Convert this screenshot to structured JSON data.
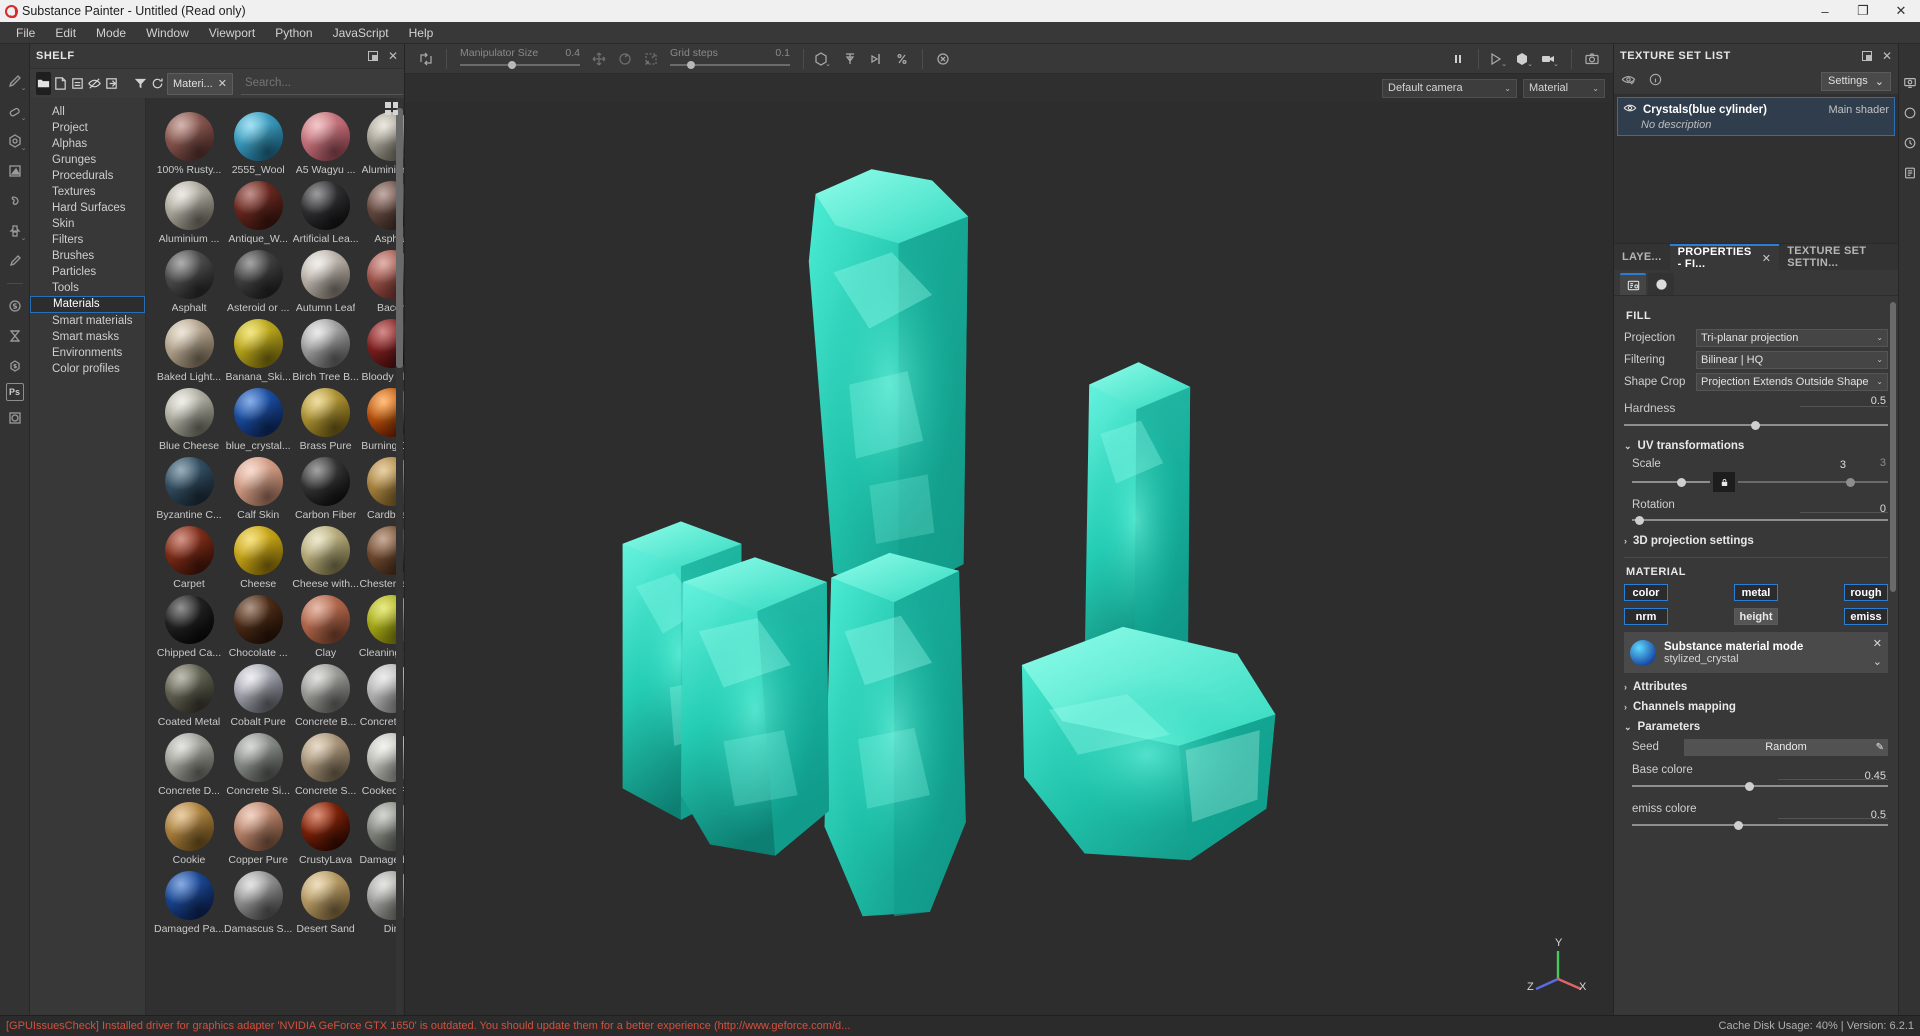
{
  "window": {
    "title": "Substance Painter - Untitled (Read only)",
    "minimize": "–",
    "maximize": "❐",
    "close": "✕"
  },
  "menubar": {
    "items": [
      "File",
      "Edit",
      "Mode",
      "Window",
      "Viewport",
      "Python",
      "JavaScript",
      "Help"
    ]
  },
  "left_toolbar": {
    "icons": [
      "paint-brush-icon",
      "eraser-icon",
      "projection-icon",
      "polygon-fill-icon",
      "smudge-icon",
      "clone-stamp-icon",
      "color-picker-icon",
      "substance-source-icon",
      "baking-icon",
      "substance-share-icon",
      "photoshop-icon",
      "export-icon"
    ]
  },
  "shelf": {
    "title": "SHELF",
    "dock_icon": "dock-icon",
    "close_icon": "close-icon",
    "toolbar": {
      "buttons": [
        "folder-icon",
        "new-file-icon",
        "save-icon",
        "hide-icon",
        "import-icon",
        "filter-icon",
        "refresh-icon"
      ],
      "chip_label": "Materi...",
      "chip_close": "✕",
      "search_placeholder": "Search..."
    },
    "categories": [
      {
        "label": "All",
        "selected": false
      },
      {
        "label": "Project",
        "selected": false
      },
      {
        "label": "Alphas",
        "selected": false
      },
      {
        "label": "Grunges",
        "selected": false
      },
      {
        "label": "Procedurals",
        "selected": false
      },
      {
        "label": "Textures",
        "selected": false
      },
      {
        "label": "Hard Surfaces",
        "selected": false
      },
      {
        "label": "Skin",
        "selected": false
      },
      {
        "label": "Filters",
        "selected": false
      },
      {
        "label": "Brushes",
        "selected": false
      },
      {
        "label": "Particles",
        "selected": false
      },
      {
        "label": "Tools",
        "selected": false
      },
      {
        "label": "Materials",
        "selected": true
      },
      {
        "label": "Smart materials",
        "selected": false
      },
      {
        "label": "Smart masks",
        "selected": false
      },
      {
        "label": "Environments",
        "selected": false
      },
      {
        "label": "Color profiles",
        "selected": false
      }
    ],
    "grid_view_icon": "grid-view-icon",
    "materials": [
      {
        "label": "100% Rusty...",
        "c1": "#b07a70",
        "c2": "#5e3430"
      },
      {
        "label": "2555_Wool",
        "c1": "#5cc8e8",
        "c2": "#1e6f92"
      },
      {
        "label": "A5 Wagyu ...",
        "c1": "#e79a9f",
        "c2": "#a04b58"
      },
      {
        "label": "Aluminium ...",
        "c1": "#d9d4c6",
        "c2": "#6e6a60"
      },
      {
        "label": "Aluminium ...",
        "c1": "#dedbd0",
        "c2": "#7b776c"
      },
      {
        "label": "Antique_W...",
        "c1": "#8f3b31",
        "c2": "#40160f"
      },
      {
        "label": "Artificial Lea...",
        "c1": "#4d4d50",
        "c2": "#141416"
      },
      {
        "label": "Asphalt",
        "c1": "#8f6a5e",
        "c2": "#3b2a24"
      },
      {
        "label": "Asphalt",
        "c1": "#6e6e6e",
        "c2": "#2a2a2a"
      },
      {
        "label": "Asteroid or ...",
        "c1": "#5c5c5c",
        "c2": "#242424"
      },
      {
        "label": "Autumn Leaf",
        "c1": "#e8e2db",
        "c2": "#8a8278"
      },
      {
        "label": "Bacon",
        "c1": "#c8766a",
        "c2": "#6e2f2a"
      },
      {
        "label": "Baked Light...",
        "c1": "#ded0bb",
        "c2": "#8a7a64"
      },
      {
        "label": "Banana_Ski...",
        "c1": "#e8d22a",
        "c2": "#8a7a10"
      },
      {
        "label": "Birch Tree B...",
        "c1": "#d8d8d8",
        "c2": "#6a6a6a"
      },
      {
        "label": "Bloody Flesh",
        "c1": "#b03030",
        "c2": "#4a0e0e"
      },
      {
        "label": "Blue Cheese",
        "c1": "#e2e2d6",
        "c2": "#7a7a6e"
      },
      {
        "label": "blue_crystal...",
        "c1": "#2a6fd4",
        "c2": "#0d2a66"
      },
      {
        "label": "Brass Pure",
        "c1": "#e0c258",
        "c2": "#7a6414"
      },
      {
        "label": "Burning Co...",
        "c1": "#ff8c1a",
        "c2": "#6e1a00"
      },
      {
        "label": "Byzantine C...",
        "c1": "#4a6e86",
        "c2": "#1c2e3c"
      },
      {
        "label": "Calf Skin",
        "c1": "#f0c0ab",
        "c2": "#b07a62"
      },
      {
        "label": "Carbon Fiber",
        "c1": "#5a5a5a",
        "c2": "#121212"
      },
      {
        "label": "Cardboard",
        "c1": "#d4a95e",
        "c2": "#7a5c24"
      },
      {
        "label": "Carpet",
        "c1": "#b0442c",
        "c2": "#4a1608"
      },
      {
        "label": "Cheese",
        "c1": "#f0cc2a",
        "c2": "#9a7c0a"
      },
      {
        "label": "Cheese with...",
        "c1": "#e0d6a8",
        "c2": "#8a8050"
      },
      {
        "label": "Chesterfield...",
        "c1": "#9a6a48",
        "c2": "#452a18"
      },
      {
        "label": "Chipped Ca...",
        "c1": "#3a3a3a",
        "c2": "#0a0a0a"
      },
      {
        "label": "Chocolate ...",
        "c1": "#6e4428",
        "c2": "#2a1408"
      },
      {
        "label": "Clay",
        "c1": "#d4866a",
        "c2": "#8a4a30"
      },
      {
        "label": "Cleaning Sp...",
        "c1": "#d4d82a",
        "c2": "#7a7c0a"
      },
      {
        "label": "Coated Metal",
        "c1": "#8a8a78",
        "c2": "#3c3c30"
      },
      {
        "label": "Cobalt Pure",
        "c1": "#e0e0e8",
        "c2": "#6a6a76"
      },
      {
        "label": "Concrete B...",
        "c1": "#c8c8c4",
        "c2": "#6e6e6a"
      },
      {
        "label": "Concrete Cl...",
        "c1": "#dcdcdc",
        "c2": "#8a8a8a"
      },
      {
        "label": "Concrete D...",
        "c1": "#cfcfc8",
        "c2": "#74746e"
      },
      {
        "label": "Concrete Si...",
        "c1": "#b8bcb8",
        "c2": "#5e625e"
      },
      {
        "label": "Concrete S...",
        "c1": "#d4bea0",
        "c2": "#7c6c54"
      },
      {
        "label": "Cooked Rice",
        "c1": "#e8e8e2",
        "c2": "#8e8e88"
      },
      {
        "label": "Cookie",
        "c1": "#d8a860",
        "c2": "#7c5a20"
      },
      {
        "label": "Copper Pure",
        "c1": "#e8b098",
        "c2": "#8a5a42"
      },
      {
        "label": "CrustyLava",
        "c1": "#c03c14",
        "c2": "#3a0a00"
      },
      {
        "label": "Damaged C...",
        "c1": "#b0b4ac",
        "c2": "#5a5e56"
      },
      {
        "label": "Damaged Pa...",
        "c1": "#2a68c8",
        "c2": "#0c2458"
      },
      {
        "label": "Damascus S...",
        "c1": "#cfcfcf",
        "c2": "#5a5a5a"
      },
      {
        "label": "Desert Sand",
        "c1": "#e0c48a",
        "c2": "#8a7040"
      },
      {
        "label": "Dirt",
        "c1": "#d0d0cc",
        "c2": "#70706c"
      }
    ]
  },
  "viewport": {
    "toolbar": {
      "transform_icon": "transform-icon",
      "manipulator": {
        "label": "Manipulator Size",
        "value": "0.4",
        "knob_pct": 40
      },
      "move_icon": "move-icon",
      "rotate_icon": "rotate-icon",
      "scale_icon": "scale-icon",
      "grid": {
        "label": "Grid steps",
        "value": "0.1",
        "knob_pct": 14
      },
      "cube_icon": "cube-icon",
      "symmetry_icon": "symmetry-icon",
      "mirror_icon": "mirror-icon",
      "fraction_icon": "fraction-icon",
      "reset_icon": "reset-icon",
      "pause_icon": "pause-icon",
      "viewmode_2d_icon": "view-2d-icon",
      "viewmode_3d_icon": "view-3d-icon",
      "viewmode_camera_icon": "view-camera-icon",
      "screenshot_icon": "screenshot-icon"
    },
    "camera_combo": "Default camera",
    "shader_combo": "Material",
    "axis": {
      "x": "X",
      "y": "Y",
      "z": "Z"
    }
  },
  "texture_set_list": {
    "title": "TEXTURE SET LIST",
    "dock_icon": "dock-icon",
    "close_icon": "close-icon",
    "eye_icon": "eye-toggle-icon",
    "info_icon": "info-icon",
    "settings_label": "Settings",
    "settings_arrow": "⌄",
    "rows": [
      {
        "name": "Crystals(blue cylinder)",
        "shader": "Main shader",
        "description": "No description",
        "visible_icon": "eye-icon"
      }
    ]
  },
  "properties": {
    "tabs": [
      {
        "label": "LAYE...",
        "active": false,
        "closable": false
      },
      {
        "label": "PROPERTIES - FI...",
        "active": true,
        "closable": true,
        "close": "✕"
      },
      {
        "label": "TEXTURE SET SETTIN...",
        "active": false,
        "closable": false
      }
    ],
    "subtabs": [
      {
        "icon": "properties-icon",
        "active": true
      },
      {
        "icon": "material-ball-icon",
        "active": false
      }
    ],
    "fill": {
      "section_title": "FILL",
      "projection": {
        "label": "Projection",
        "value": "Tri-planar projection"
      },
      "filtering": {
        "label": "Filtering",
        "value": "Bilinear | HQ"
      },
      "shape_crop": {
        "label": "Shape Crop",
        "value": "Projection Extends Outside Shape"
      },
      "hardness": {
        "label": "Hardness",
        "value": "0.5",
        "knob_pct": 48
      },
      "uv_transformations": {
        "label": "UV transformations",
        "expanded": true,
        "scale": {
          "label": "Scale",
          "value_left": "3",
          "value_right": "3",
          "knob_left_pct": 58,
          "knob_right_pct": 72,
          "lock_icon": "lock-icon"
        },
        "rotation": {
          "label": "Rotation",
          "value": "0",
          "knob_pct": 2
        }
      },
      "projection_3d": {
        "label": "3D projection settings",
        "expanded": false
      }
    },
    "material": {
      "section_title": "MATERIAL",
      "channels": [
        {
          "label": "color",
          "on": true
        },
        {
          "label": "metal",
          "on": true
        },
        {
          "label": "rough",
          "on": true
        },
        {
          "label": "nrm",
          "on": true
        },
        {
          "label": "height",
          "on": false
        },
        {
          "label": "emiss",
          "on": true
        }
      ],
      "mode": {
        "title": "Substance material mode",
        "value": "stylized_crystal",
        "close": "✕",
        "arrow": "⌄",
        "thumb_icon": "crystal-thumb-icon"
      },
      "attributes": {
        "label": "Attributes",
        "expanded": false
      },
      "channels_mapping": {
        "label": "Channels mapping",
        "expanded": false
      },
      "parameters": {
        "label": "Parameters",
        "expanded": true,
        "seed": {
          "label": "Seed",
          "value": "Random",
          "edit_icon": "pencil-icon"
        },
        "base_colore": {
          "label": "Base colore",
          "value": "0.45",
          "knob_pct": 44
        },
        "emiss_colore": {
          "label": "emiss colore",
          "value": "0.5",
          "knob_pct": 40
        }
      }
    }
  },
  "right_rail": {
    "icons": [
      "display-settings-icon",
      "shader-settings-icon",
      "history-icon",
      "log-icon"
    ]
  },
  "statusbar": {
    "message": "[GPUIssuesCheck] Installed driver for graphics adapter 'NVIDIA GeForce GTX 1650' is outdated. You should update them for a better experience (http://www.geforce.com/d...",
    "cache": "Cache Disk Usage:   40% | Version: 6.2.1"
  },
  "colors": {
    "accent_blue": "#2a7fd4",
    "crystal_teal": "#2ee0c8",
    "error_red": "#d4503c"
  }
}
